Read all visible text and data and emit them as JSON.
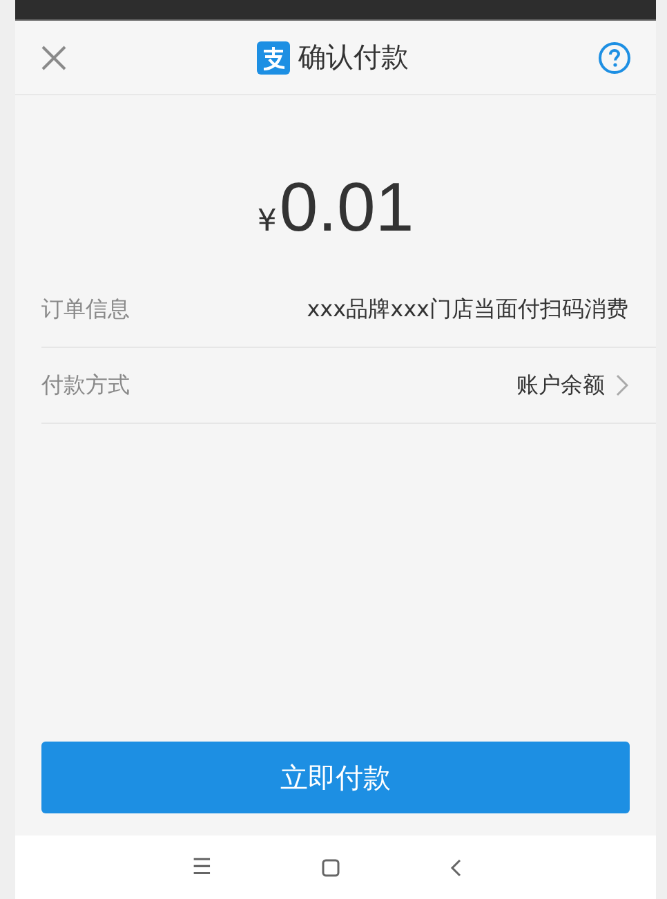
{
  "header": {
    "title": "确认付款"
  },
  "amount": {
    "currency": "¥",
    "value": "0.01"
  },
  "rows": [
    {
      "label": "订单信息",
      "value": "xxx品牌xxx门店当面付扫码消费",
      "chevron": false
    },
    {
      "label": "付款方式",
      "value": "账户余额",
      "chevron": true
    }
  ],
  "pay_button": {
    "label": "立即付款"
  },
  "nav_bar": {
    "menu": "☰"
  }
}
